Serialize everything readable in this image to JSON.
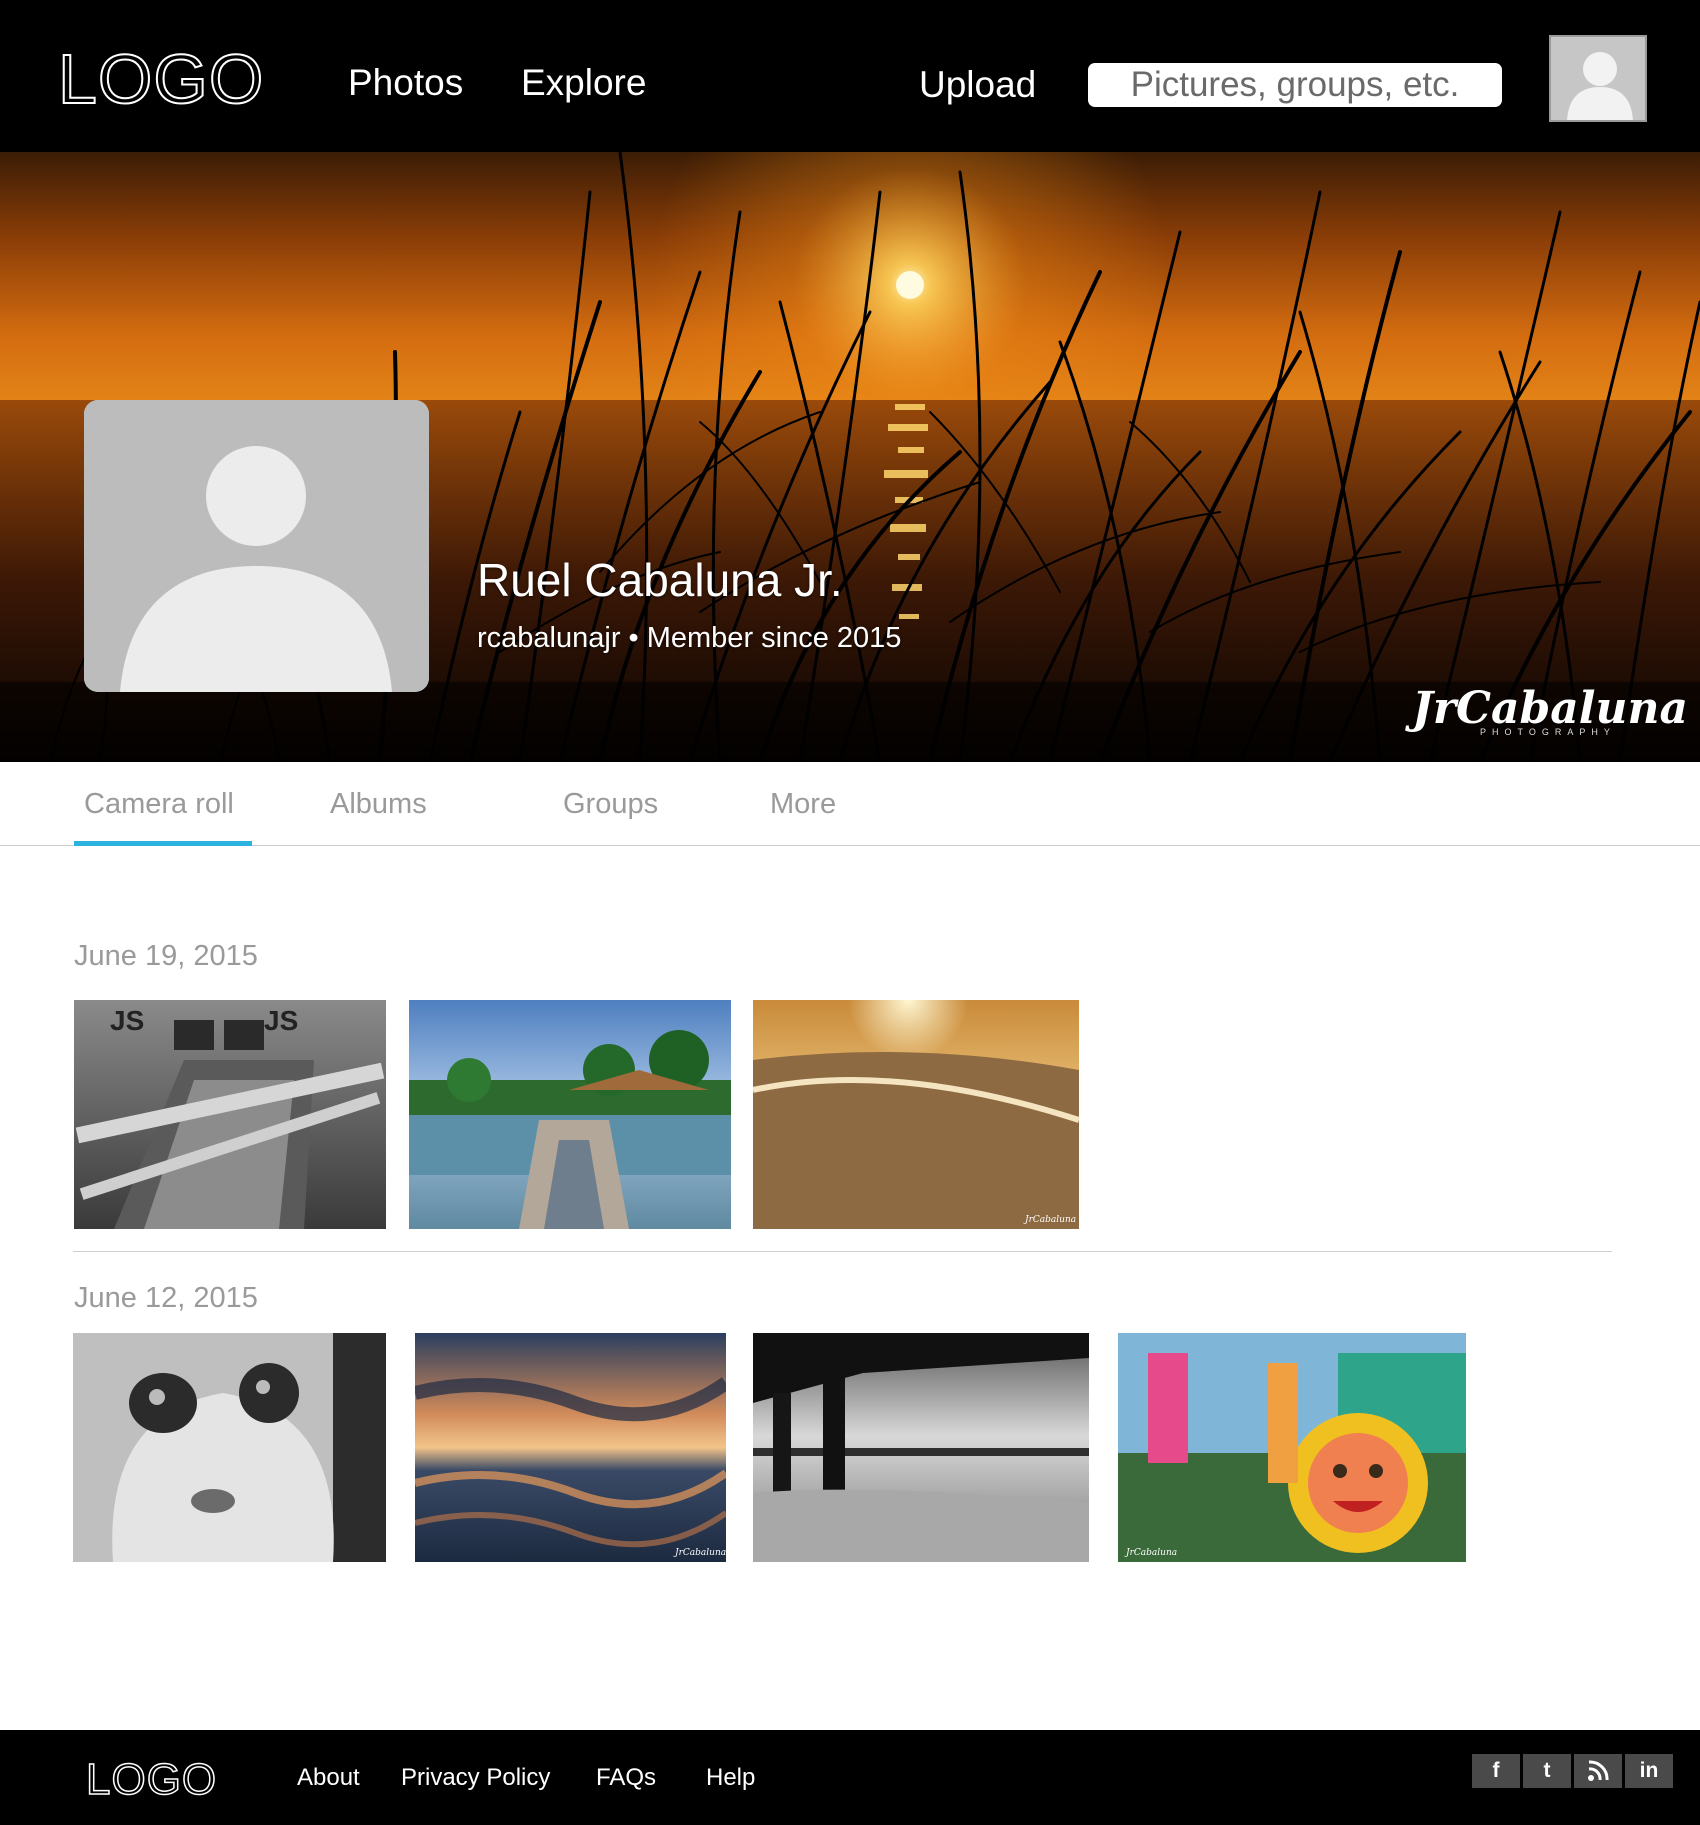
{
  "header": {
    "logo": "LOGO",
    "nav": {
      "photos": "Photos",
      "explore": "Explore"
    },
    "upload": "Upload",
    "search_placeholder": "Pictures, groups, etc."
  },
  "profile": {
    "name": "Ruel Cabaluna Jr.",
    "meta": "rcabalunajr • Member since 2015",
    "watermark": "JrCabaluna",
    "watermark_sub": "PHOTOGRAPHY"
  },
  "tabs": [
    {
      "label": "Camera roll",
      "active": true
    },
    {
      "label": "Albums"
    },
    {
      "label": "Groups"
    },
    {
      "label": "More"
    }
  ],
  "sections": [
    {
      "date": "June 19, 2015",
      "photos": [
        "boat-black-and-white",
        "beach-huts-palms",
        "sunset-beach-footprints"
      ]
    },
    {
      "date": "June 12, 2015",
      "photos": [
        "cat-close-up",
        "sunset-reflection",
        "pier-seascape",
        "festival-sun-mascot"
      ]
    }
  ],
  "footer": {
    "logo": "LOGO",
    "links": [
      "About",
      "Privacy Policy",
      "FAQs",
      "Help"
    ],
    "social": [
      {
        "icon": "facebook-icon",
        "glyph": "f"
      },
      {
        "icon": "twitter-icon",
        "glyph": "t"
      },
      {
        "icon": "rss-icon",
        "glyph": ""
      },
      {
        "icon": "linkedin-icon",
        "glyph": "in"
      }
    ]
  },
  "colors": {
    "accent": "#2bb2de",
    "bar": "#000000",
    "muted_text": "#9a9a9a"
  }
}
